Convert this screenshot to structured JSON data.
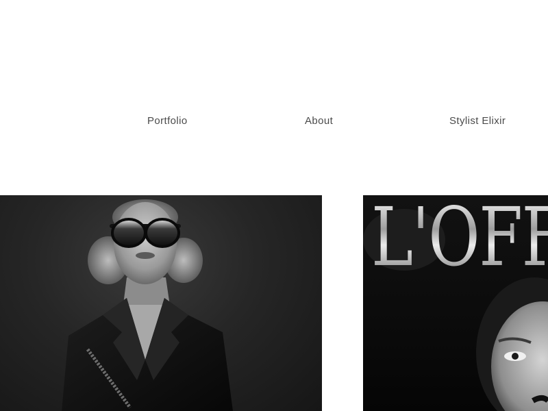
{
  "nav": {
    "items": [
      {
        "label": "Portfolio"
      },
      {
        "label": "About"
      },
      {
        "label": "Stylist Elixir"
      }
    ]
  },
  "gallery": {
    "tiles": [
      {
        "kind": "photo",
        "subject": "portrait-sunglasses-blazer"
      },
      {
        "kind": "magazine-cover",
        "masthead": "L'OFFI"
      }
    ]
  },
  "colors": {
    "background": "#ffffff",
    "nav_text": "#4a4a4a",
    "photo_dark": "#1c1c1c"
  }
}
